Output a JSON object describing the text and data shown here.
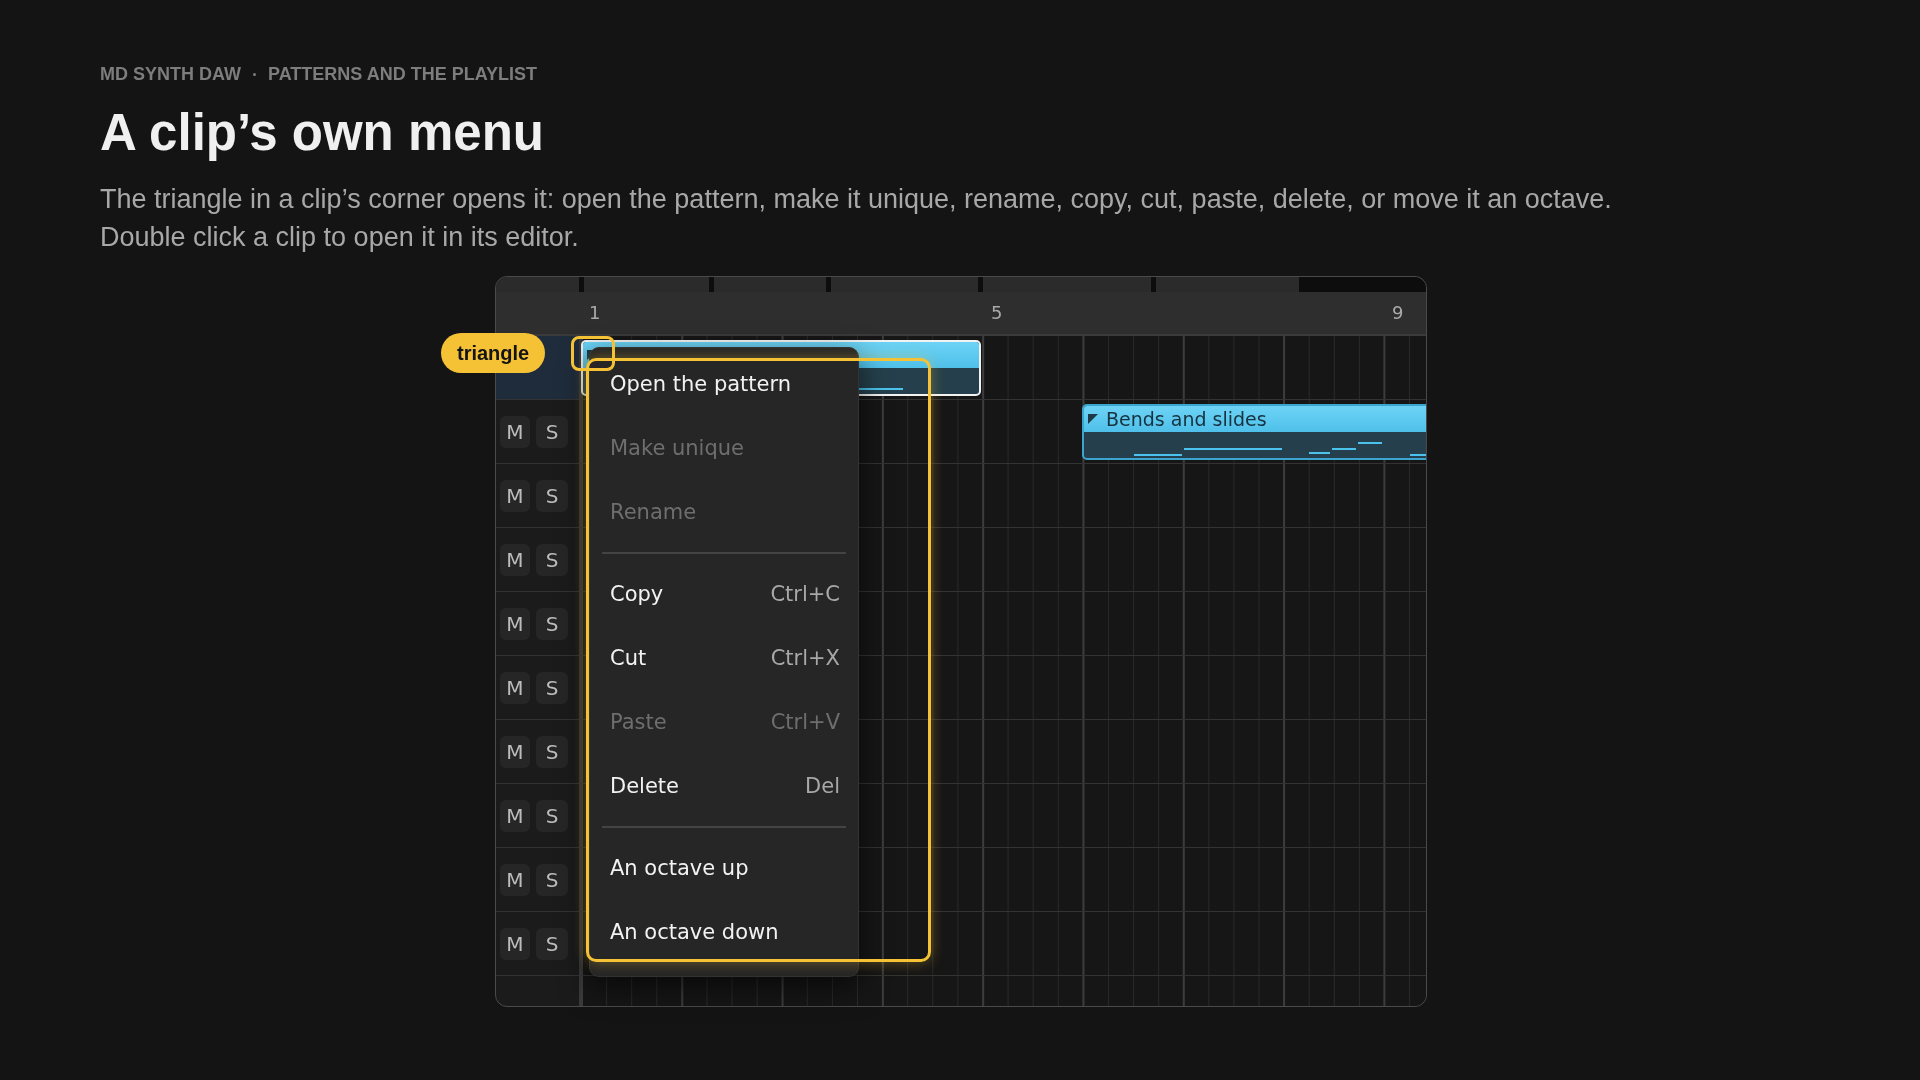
{
  "breadcrumb": [
    "MD SYNTH DAW",
    "PATTERNS AND THE PLAYLIST"
  ],
  "title": "A clip’s own menu",
  "description": "The triangle in a clip’s corner opens it: open the pattern, make it unique, rename, copy, cut, paste, delete, or move it an octave. Double click a clip to open it in its editor.",
  "ruler": [
    "1",
    "5",
    "9"
  ],
  "tracks": [
    {
      "selected": true
    },
    {
      "mute": "M",
      "solo": "S",
      "selected": false
    },
    {
      "mute": "M",
      "solo": "S",
      "selected": false
    },
    {
      "mute": "M",
      "solo": "S",
      "selected": false
    },
    {
      "mute": "M",
      "solo": "S",
      "selected": false
    },
    {
      "mute": "M",
      "solo": "S",
      "selected": false
    },
    {
      "mute": "M",
      "solo": "S",
      "selected": false
    },
    {
      "mute": "M",
      "solo": "S",
      "selected": false
    },
    {
      "mute": "M",
      "solo": "S",
      "selected": false
    },
    {
      "mute": "M",
      "solo": "S",
      "selected": false
    }
  ],
  "clips": [
    {
      "selected": true
    },
    {
      "name": "Bends and slides",
      "selected": false
    }
  ],
  "menu": [
    {
      "kind": "item",
      "label": "Open the pattern",
      "disabled": false
    },
    {
      "kind": "item",
      "label": "Make unique",
      "disabled": true
    },
    {
      "kind": "item",
      "label": "Rename",
      "disabled": true
    },
    {
      "kind": "separator"
    },
    {
      "kind": "item",
      "label": "Copy",
      "shortcut": "Ctrl+C",
      "disabled": false
    },
    {
      "kind": "item",
      "label": "Cut",
      "shortcut": "Ctrl+X",
      "disabled": false
    },
    {
      "kind": "item",
      "label": "Paste",
      "shortcut": "Ctrl+V",
      "disabled": true
    },
    {
      "kind": "item",
      "label": "Delete",
      "shortcut": "Del",
      "disabled": false
    },
    {
      "kind": "separator"
    },
    {
      "kind": "item",
      "label": "An octave up",
      "disabled": false
    },
    {
      "kind": "item",
      "label": "An octave down",
      "disabled": false
    }
  ],
  "callout": {
    "label": "triangle"
  }
}
